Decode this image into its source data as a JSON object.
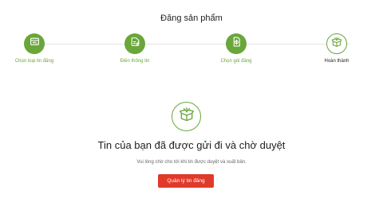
{
  "page": {
    "title": "Đăng sản phẩm"
  },
  "steps": [
    {
      "label": "Chọn loại tin đăng",
      "icon": "listing-type-icon",
      "status": "done"
    },
    {
      "label": "Điền thông tin",
      "icon": "edit-document-icon",
      "status": "done"
    },
    {
      "label": "Chọn gói đăng",
      "icon": "payment-document-icon",
      "status": "done"
    },
    {
      "label": "Hoàn thành",
      "icon": "open-box-icon",
      "status": "current"
    }
  ],
  "result": {
    "icon": "open-box-icon",
    "title": "Tin của bạn đã được gửi đi và chờ duyệt",
    "subtitle": "Vui lòng chờ cho tới khi tin được duyệt và xuất bản.",
    "button_label": "Quản lý tin đăng"
  },
  "colors": {
    "accent": "#6aa63a",
    "button": "#e03a2b"
  }
}
